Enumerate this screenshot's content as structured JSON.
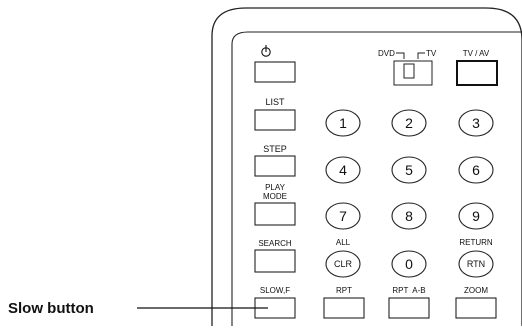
{
  "callout": {
    "text": "Slow button"
  },
  "power": {
    "icon": "power-icon"
  },
  "switch": {
    "left": "DVD",
    "right": "TV"
  },
  "rect_buttons": {
    "tvav": "TV / AV",
    "list": "LIST",
    "step": "STEP",
    "playmode_1": "PLAY",
    "playmode_2": "MODE",
    "search": "SEARCH",
    "slowf": "SLOW,F",
    "rpt": "RPT",
    "rpt_ab": "RPT  A-B",
    "zoom": "ZOOM"
  },
  "numbers": [
    "1",
    "2",
    "3",
    "4",
    "5",
    "6",
    "7",
    "8",
    "9",
    "0"
  ],
  "circle_labels": {
    "all": "ALL",
    "clr": "CLR",
    "return": "RETURN",
    "rtn": "RTN"
  }
}
